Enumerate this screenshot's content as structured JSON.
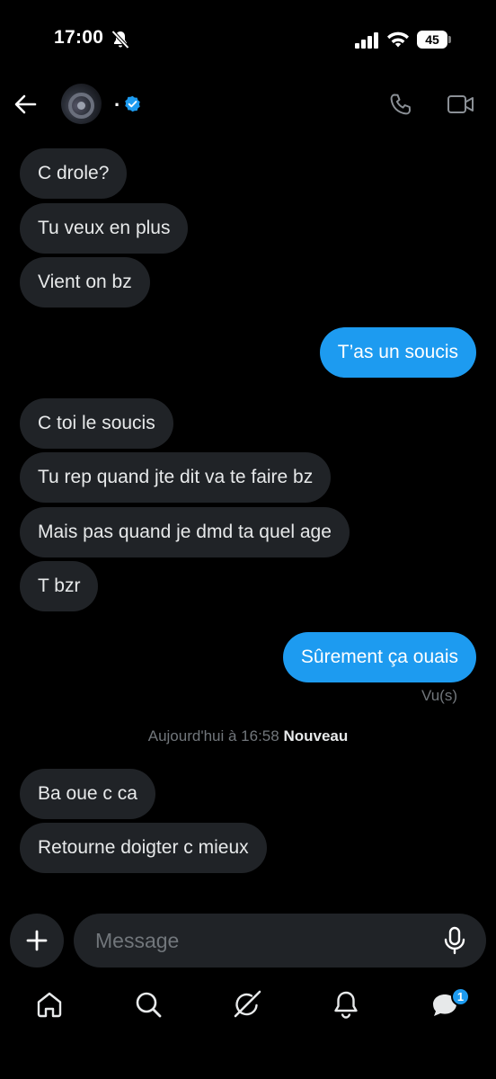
{
  "status_bar": {
    "time": "17:00",
    "battery": "45",
    "icons": [
      "bell-slash-icon",
      "cellular-signal-icon",
      "wifi-icon",
      "battery-icon"
    ]
  },
  "header": {
    "name": ".",
    "verified": true,
    "icons": [
      "back-arrow-icon",
      "avatar",
      "verified-badge-icon",
      "phone-icon",
      "video-camera-icon"
    ]
  },
  "messages": [
    {
      "text": "C drole?",
      "direction": "received"
    },
    {
      "text": "Tu veux en plus",
      "direction": "received"
    },
    {
      "text": "Vient on bz",
      "direction": "received"
    },
    {
      "text": "T’as un soucis",
      "direction": "sent"
    },
    {
      "text": "C toi le soucis",
      "direction": "received"
    },
    {
      "text": "Tu rep quand jte dit va te faire bz",
      "direction": "received"
    },
    {
      "text": "Mais pas quand je dmd ta quel age",
      "direction": "received"
    },
    {
      "text": "T bzr",
      "direction": "received"
    },
    {
      "text": "Sûrement ça ouais",
      "direction": "sent"
    },
    {
      "text": "Ba oue c ca",
      "direction": "received"
    },
    {
      "text": "Retourne doigter c mieux",
      "direction": "received"
    }
  ],
  "seen_label": "Vu(s)",
  "divider": {
    "timestamp": "Aujourd'hui à 16:58",
    "new_label": "Nouveau"
  },
  "composer": {
    "placeholder": "Message",
    "icons": [
      "plus-icon",
      "microphone-icon"
    ]
  },
  "bottom_nav": {
    "items": [
      "home-icon",
      "search-icon",
      "grok-icon",
      "notifications-icon",
      "messages-icon"
    ],
    "messages_badge": "1"
  },
  "colors": {
    "background": "#000000",
    "received_bubble": "#202327",
    "sent_bubble": "#1d9bf0",
    "secondary_text": "#71767b"
  }
}
